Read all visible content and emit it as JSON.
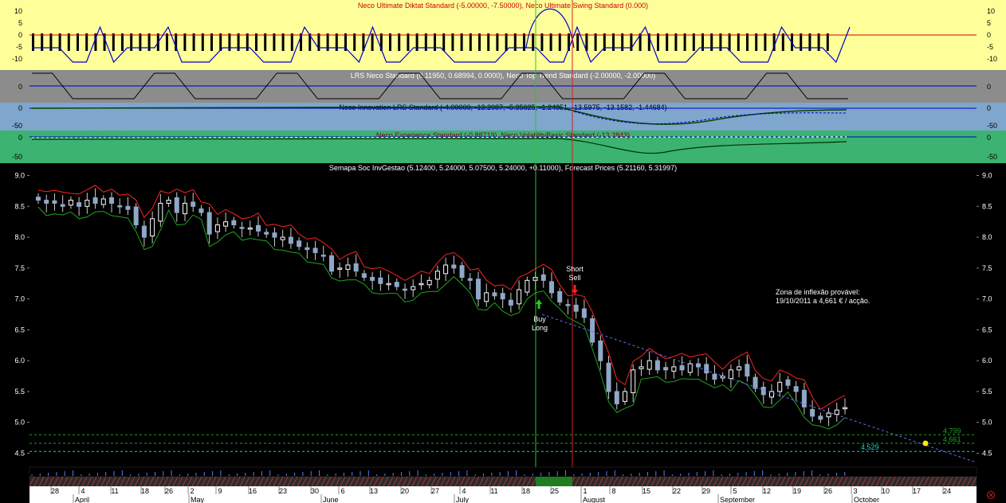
{
  "colors": {
    "panel1_bg": "#ffff99",
    "panel2_bg": "#8c8c8c",
    "panel3_bg": "#7fa6cc",
    "panel4_bg": "#3cb371",
    "main_bg": "#000000",
    "bull_candle": "#ffffff",
    "bear_candle": "#8fa8c8",
    "up_band": "#ff2020",
    "down_band": "#1fa31f",
    "buy_line": "#22cc22",
    "sell_line": "#cc2222",
    "forecast_line": "#6a6aff",
    "support_line": "#22cccc",
    "resistance_line": "#1fa31f",
    "forecast_dot": "#ffee00"
  },
  "panels": {
    "p1": {
      "title": "Neco Ultimate Diktat Standard (-5.00000, -7.50000), Neco Ultimate Swing Standard (0.000)",
      "ticks": [
        "10",
        "5",
        "0",
        "-5",
        "-10"
      ]
    },
    "p2": {
      "title": "LRS Neco Standard (0.11950, 0.68994, 0.0000), Neco Top Trend Standard (-2.00000, -2.00000)",
      "ticks": [
        "0"
      ]
    },
    "p3": {
      "title": "Neco Innovation LRS Standard (-4.00000, -13.2087, -5.35625, -1.24851, -13.5975, -13.1582, -1.44684)",
      "ticks": [
        "0",
        "-50"
      ]
    },
    "p4": {
      "title": "Neco Experience Standard (-0.88719), Neco VolatilityBasic Standard (-13.2843)",
      "ticks": [
        "0",
        "-50"
      ]
    }
  },
  "chart_data": {
    "type": "candlestick",
    "title": "Semapa Soc InvGestao (5.12400, 5.24000, 5.07500, 5.24000, +0.11000), Forecast Prices (5.21160, 5.31997)",
    "ylim": [
      4.3,
      9.2
    ],
    "yticks": [
      "9.0",
      "8.5",
      "8.0",
      "7.5",
      "7.0",
      "6.5",
      "6.0",
      "5.5",
      "5.0",
      "4.5"
    ],
    "xaxis": {
      "day_labels": [
        "28",
        "4",
        "11",
        "18",
        "26",
        "2",
        "9",
        "16",
        "23",
        "30",
        "6",
        "13",
        "20",
        "27",
        "4",
        "11",
        "18",
        "25",
        "1",
        "8",
        "15",
        "22",
        "29",
        "5",
        "12",
        "19",
        "26",
        "3",
        "10",
        "17",
        "24"
      ],
      "month_labels": [
        "April",
        "May",
        "June",
        "July",
        "August",
        "September",
        "October"
      ]
    },
    "close": [
      8.6,
      8.55,
      8.55,
      8.5,
      8.6,
      8.5,
      8.6,
      8.55,
      8.62,
      8.55,
      8.5,
      8.45,
      8.2,
      8.0,
      8.3,
      8.55,
      8.6,
      8.4,
      8.55,
      8.5,
      8.4,
      8.05,
      8.2,
      8.25,
      8.2,
      8.15,
      8.15,
      8.1,
      8.05,
      8.0,
      8.0,
      7.9,
      7.85,
      7.8,
      7.75,
      7.7,
      7.45,
      7.5,
      7.55,
      7.45,
      7.35,
      7.3,
      7.25,
      7.25,
      7.2,
      7.15,
      7.2,
      7.25,
      7.3,
      7.45,
      7.55,
      7.5,
      7.35,
      7.3,
      7.0,
      7.1,
      7.05,
      7.0,
      6.9,
      7.15,
      7.3,
      7.35,
      7.3,
      7.1,
      6.95,
      6.9,
      6.8,
      6.7,
      6.3,
      6.0,
      5.5,
      5.3,
      5.5,
      5.85,
      5.9,
      6.0,
      5.85,
      5.85,
      5.9,
      5.85,
      5.95,
      5.9,
      5.8,
      5.7,
      5.75,
      5.85,
      5.9,
      5.75,
      5.55,
      5.45,
      5.5,
      5.65,
      5.6,
      5.5,
      5.25,
      5.1,
      5.05,
      5.15,
      5.2,
      5.24
    ],
    "signals": [
      {
        "label1": "Buy",
        "label2": "Long"
      },
      {
        "label1": "Short",
        "label2": "Sell"
      }
    ],
    "annotation": {
      "line1": "Zona de inflexão provável:",
      "line2": "19/10/2011 a 4,661 € / acção."
    },
    "levels": [
      {
        "label": "4,799",
        "value": 4.799
      },
      {
        "label": "4,661",
        "value": 4.661
      },
      {
        "label": "4,529",
        "value": 4.529
      }
    ],
    "forecast_point": {
      "value": 4.661
    }
  }
}
